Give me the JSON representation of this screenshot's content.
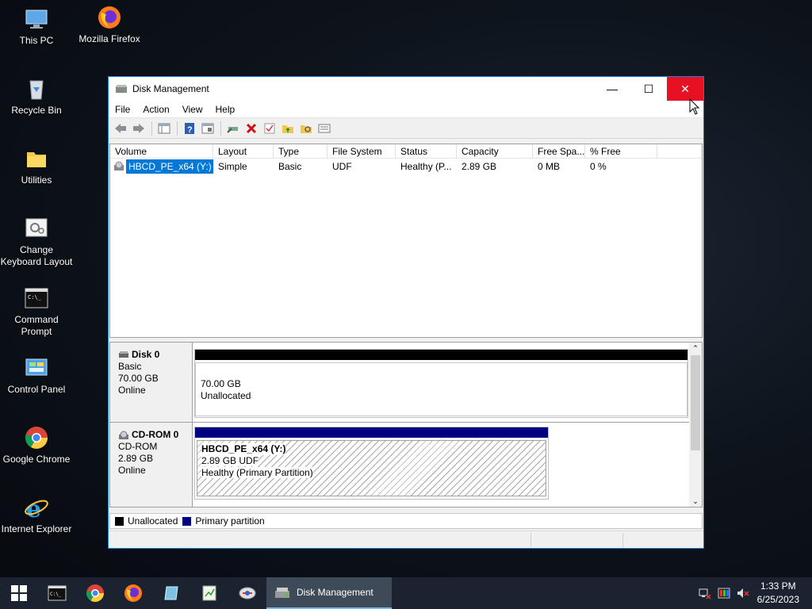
{
  "desktop": {
    "icons": [
      {
        "label": "This PC"
      },
      {
        "label": "Mozilla Firefox"
      },
      {
        "label": "Recycle Bin"
      },
      {
        "label": "Utilities"
      },
      {
        "label": "Change Keyboard Layout"
      },
      {
        "label": "Command Prompt"
      },
      {
        "label": "Control Panel"
      },
      {
        "label": "Google Chrome"
      },
      {
        "label": "Internet Explorer"
      }
    ]
  },
  "window": {
    "title": "Disk Management",
    "minimize_glyph": "—",
    "maximize_glyph": "☐",
    "close_glyph": "✕"
  },
  "menu": [
    "File",
    "Action",
    "View",
    "Help"
  ],
  "toolbar": {
    "icons": [
      "back-icon",
      "forward-icon",
      "console-tree-icon",
      "help-icon",
      "properties-icon",
      "rescan-icon",
      "delete-icon",
      "check-icon",
      "folder-up-icon",
      "search-folder-icon",
      "list-icon"
    ]
  },
  "volume_list": {
    "columns": [
      "Volume",
      "Layout",
      "Type",
      "File System",
      "Status",
      "Capacity",
      "Free Spa...",
      "% Free"
    ],
    "rows": [
      {
        "volume": "HBCD_PE_x64 (Y:)",
        "layout": "Simple",
        "type": "Basic",
        "fs": "UDF",
        "status": "Healthy (P...",
        "capacity": "2.89 GB",
        "free": "0 MB",
        "pct": "0 %"
      }
    ]
  },
  "disks": [
    {
      "name": "Disk 0",
      "type": "Basic",
      "size": "70.00 GB",
      "state": "Online",
      "partition": {
        "size": "70.00 GB",
        "label": "Unallocated"
      }
    },
    {
      "name": "CD-ROM 0",
      "type": "CD-ROM",
      "size": "2.89 GB",
      "state": "Online",
      "partition": {
        "title": "HBCD_PE_x64  (Y:)",
        "detail": "2.89 GB UDF",
        "status": "Healthy (Primary Partition)"
      }
    }
  ],
  "legend": {
    "unallocated": "Unallocated",
    "primary": "Primary partition",
    "unallocated_color": "#000000",
    "primary_color": "#000080"
  },
  "taskbar": {
    "active_label": "Disk Management",
    "time": "1:33 PM",
    "date": "6/25/2023"
  }
}
